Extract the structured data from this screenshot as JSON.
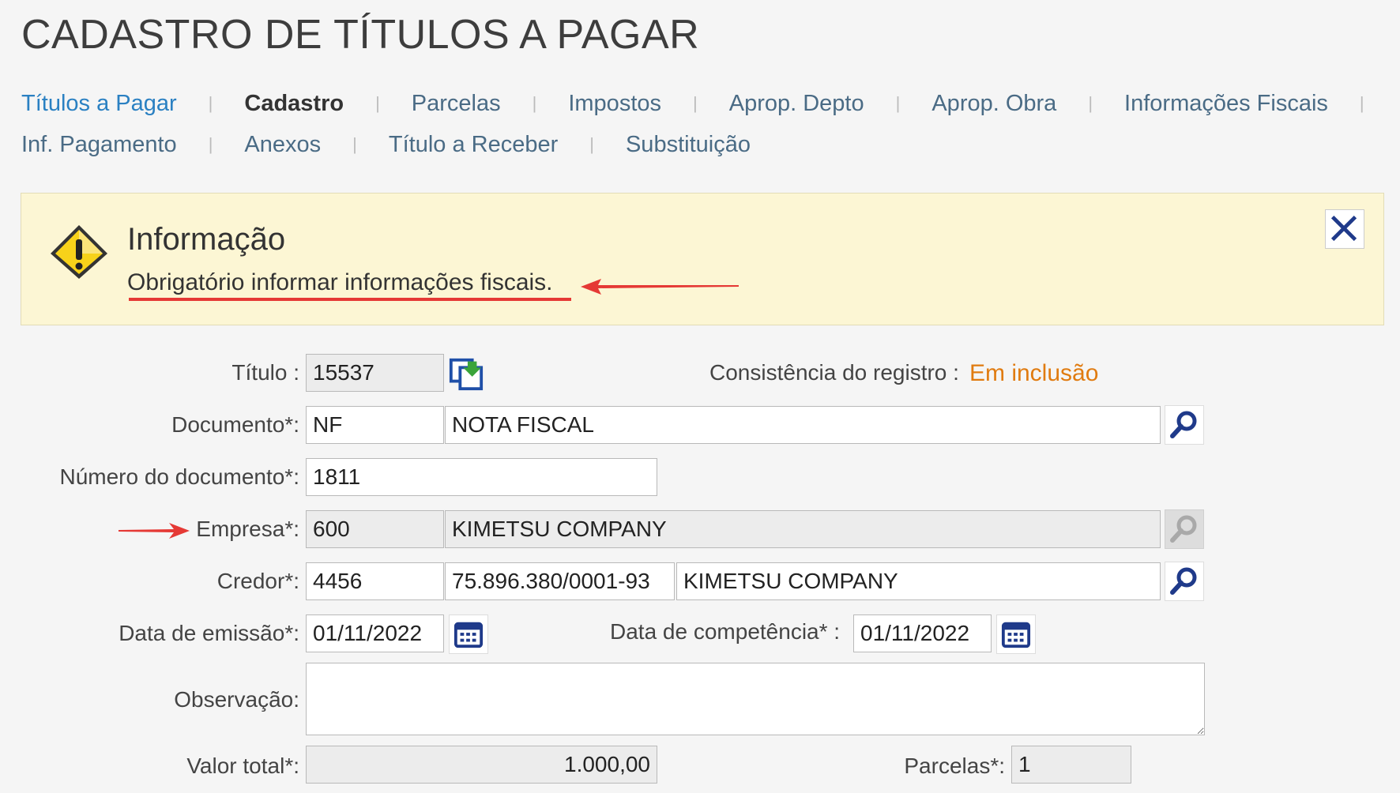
{
  "page": {
    "title": "CADASTRO DE TÍTULOS A PAGAR"
  },
  "tabs_row1": [
    {
      "label": "Títulos a Pagar"
    },
    {
      "label": "Cadastro"
    },
    {
      "label": "Parcelas"
    },
    {
      "label": "Impostos"
    },
    {
      "label": "Aprop. Depto"
    },
    {
      "label": "Aprop. Obra"
    },
    {
      "label": "Informações Fiscais"
    }
  ],
  "tabs_row2": [
    {
      "label": "Inf. Pagamento"
    },
    {
      "label": "Anexos"
    },
    {
      "label": "Título a Receber"
    },
    {
      "label": "Substituição"
    }
  ],
  "alert": {
    "title": "Informação",
    "message": "Obrigatório informar informações fiscais.",
    "icon": "warning-icon",
    "close_icon": "close-icon",
    "highlight_color": "#e53935"
  },
  "form": {
    "titulo": {
      "label": "Título :",
      "value": "15537"
    },
    "consistencia": {
      "label": "Consistência do registro :",
      "value": "Em inclusão",
      "value_color": "#e07b10"
    },
    "documento": {
      "label": "Documento*:",
      "code": "NF",
      "name": "NOTA FISCAL"
    },
    "numero_documento": {
      "label": "Número do documento*:",
      "value": "1811"
    },
    "empresa": {
      "label": "Empresa*:",
      "code": "600",
      "name": "KIMETSU COMPANY"
    },
    "credor": {
      "label": "Credor*:",
      "code": "4456",
      "cnpj": "75.896.380/0001-93",
      "name": "KIMETSU COMPANY"
    },
    "data_emissao": {
      "label": "Data de emissão*:",
      "value": "01/11/2022"
    },
    "data_competencia": {
      "label": "Data de competência* :",
      "value": "01/11/2022"
    },
    "observacao": {
      "label": "Observação:",
      "value": ""
    },
    "valor_total": {
      "label": "Valor total*:",
      "value": "1.000,00"
    },
    "parcelas": {
      "label": "Parcelas*:",
      "value": "1"
    }
  },
  "icons": {
    "search": "search-icon",
    "calendar": "calendar-icon",
    "copy": "copy-title-icon"
  }
}
